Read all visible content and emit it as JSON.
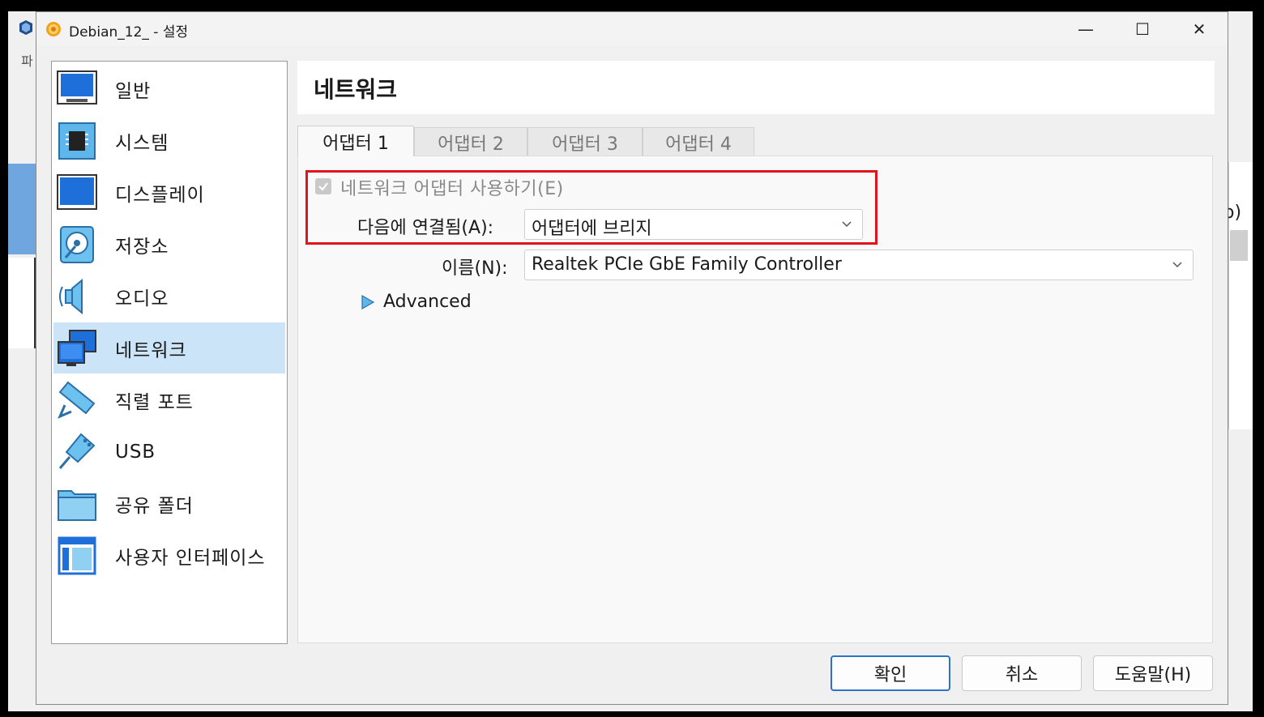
{
  "window": {
    "title": "Debian_12_ - 설정",
    "minimize": "—",
    "maximize": "☐",
    "close": "✕"
  },
  "background": {
    "menu_glyph": "파",
    "right_text": "o)"
  },
  "sidebar": {
    "items": [
      {
        "label": "일반",
        "icon": "general-monitor-icon"
      },
      {
        "label": "시스템",
        "icon": "system-chip-icon"
      },
      {
        "label": "디스플레이",
        "icon": "display-monitor-icon"
      },
      {
        "label": "저장소",
        "icon": "storage-disk-icon"
      },
      {
        "label": "오디오",
        "icon": "audio-speaker-icon"
      },
      {
        "label": "네트워크",
        "icon": "network-monitors-icon",
        "selected": true
      },
      {
        "label": "직렬 포트",
        "icon": "serial-port-icon"
      },
      {
        "label": "USB",
        "icon": "usb-icon"
      },
      {
        "label": "공유 폴더",
        "icon": "shared-folder-icon"
      },
      {
        "label": "사용자 인터페이스",
        "icon": "user-interface-icon"
      }
    ]
  },
  "main": {
    "section_title": "네트워크",
    "tabs": [
      {
        "label": "어댑터 1",
        "active": true
      },
      {
        "label": "어댑터 2"
      },
      {
        "label": "어댑터 3"
      },
      {
        "label": "어댑터 4"
      }
    ],
    "enable_adapter": {
      "label": "네트워크 어댑터 사용하기(E)",
      "checked": true,
      "disabled": true
    },
    "attached_to": {
      "label": "다음에 연결됨(A):",
      "value": "어댑터에 브리지"
    },
    "name": {
      "label": "이름(N):",
      "value": "Realtek PCIe GbE Family Controller"
    },
    "advanced": {
      "label": "Advanced"
    }
  },
  "buttons": {
    "ok": "확인",
    "cancel": "취소",
    "help": "도움말(H)"
  },
  "colors": {
    "selection": "#cce4f7",
    "highlight_box": "#e0141c",
    "accent": "#2d74c8",
    "icon_blue": "#1e6fd9"
  }
}
